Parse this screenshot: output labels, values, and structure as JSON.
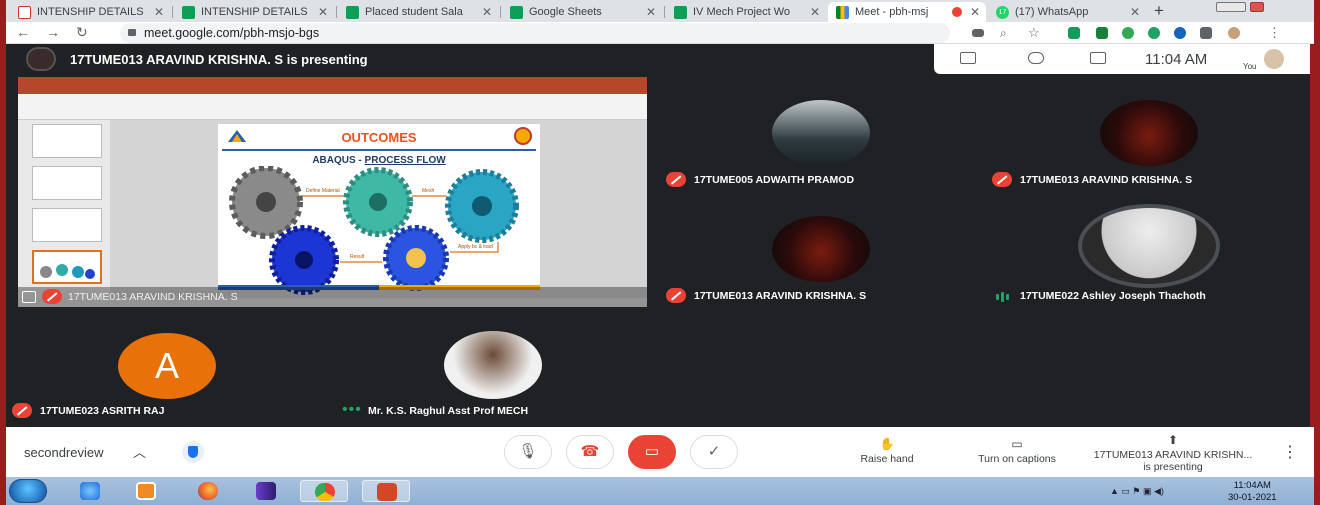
{
  "browser": {
    "tabs": [
      {
        "title": "INTENSHIP DETAILS",
        "icon": "gmail-icon",
        "color": "#d93025"
      },
      {
        "title": "INTENSHIP DETAILS",
        "icon": "sheets-icon",
        "color": "#0f9d58"
      },
      {
        "title": "Placed student Sala",
        "icon": "sheets-icon",
        "color": "#0f9d58"
      },
      {
        "title": "Google Sheets",
        "icon": "sheets-icon",
        "color": "#0f9d58"
      },
      {
        "title": "IV Mech Project Wo",
        "icon": "docs-icon",
        "color": "#1a73e8"
      },
      {
        "title": "Meet - pbh-msj",
        "icon": "meet-icon",
        "color": "#00897b",
        "active": true
      },
      {
        "title": "(17) WhatsApp",
        "icon": "whatsapp-icon",
        "color": "#25d366",
        "badge": "17"
      }
    ],
    "url": "meet.google.com/pbh-msjo-bgs",
    "new_tab": "+"
  },
  "meet": {
    "presenter_title": "17TUME013 ARAVIND KRISHNA. S is presenting",
    "clock": "11:04 AM",
    "you_label": "You",
    "presentation_tile_name": "17TUME013 ARAVIND KRISHNA. S",
    "slide": {
      "title": "OUTCOMES",
      "subtitle_prefix": "ABAQUS - ",
      "subtitle_underlined": "PROCESS FLOW",
      "steps": [
        "Define Material",
        "Mesh",
        "Apply bc & load",
        "Result"
      ]
    },
    "participants": [
      {
        "name": "17TUME005 ADWAITH PRAMOD",
        "status": "muted"
      },
      {
        "name": "17TUME013 ARAVIND KRISHNA. S",
        "status": "muted"
      },
      {
        "name": "17TUME013 ARAVIND KRISHNA. S",
        "status": "muted"
      },
      {
        "name": "17TUME022 Ashley Joseph Thachoth",
        "status": "speaking"
      },
      {
        "name": "17TUME023 ASRITH RAJ",
        "status": "muted",
        "initial": "A",
        "avatar_color": "#e8710a"
      },
      {
        "name": "Mr. K.S. Raghul Asst Prof MECH",
        "status": "active"
      }
    ],
    "bottom": {
      "meeting_code": "secondreview",
      "raise_hand": "Raise hand",
      "captions": "Turn on captions",
      "presenting_line1": "17TUME013 ARAVIND KRISHN...",
      "presenting_line2": "is presenting"
    }
  },
  "taskbar": {
    "time": "11:04AM",
    "date": "30-01-2021"
  },
  "colors": {
    "meet_bg": "#202124",
    "muted_red": "#ea4335",
    "accent_green": "#1ea362"
  }
}
